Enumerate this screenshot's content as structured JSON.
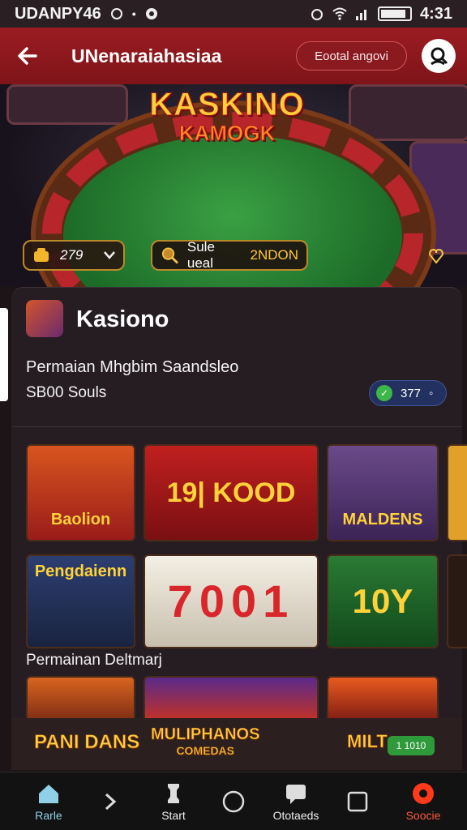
{
  "statusbar": {
    "left_text": "UDANPY46",
    "time": "4:31"
  },
  "appbar": {
    "title": "UNenaraiahasiaa",
    "action_label": "Eootal angovi"
  },
  "hero": {
    "title_line1": "KASKINO",
    "title_line2": "KAMOGK",
    "coin_value": "279",
    "search_label": "Sule ueal",
    "search_highlight": "2NDON"
  },
  "category": {
    "title": "Kasiono",
    "description1": "Permaian Mhgbim Saandsleo",
    "description2": "SB00 Souls",
    "score": "377"
  },
  "games_row1": [
    {
      "label": "Baolion",
      "bg": "#b4331f"
    },
    {
      "label": "19| KOOD",
      "bg": "#a8171b"
    },
    {
      "label": "MALDENS",
      "bg": "#5a3b7a"
    }
  ],
  "games_row2": [
    {
      "label": "Pengdaienn",
      "bg": "#26345a"
    },
    {
      "label": "7001",
      "bg": "#e8e1d2"
    },
    {
      "label": "10Y",
      "bg": "#1f6a2c"
    }
  ],
  "section2_title": "Permainan Deltmarj",
  "promo": {
    "item1": "PANI DANS",
    "item2_line1": "MULIPHANOS",
    "item2_line2": "COMEDAS",
    "item3": "MILT",
    "badge": "1 1010"
  },
  "bottom_nav": [
    {
      "label": "Rarle",
      "icon": "home-icon"
    },
    {
      "label": "",
      "icon": "chevron-right-icon"
    },
    {
      "label": "Start",
      "icon": "rook-icon"
    },
    {
      "label": "",
      "icon": "circle-icon"
    },
    {
      "label": "Ototaeds",
      "icon": "chat-icon"
    },
    {
      "label": "",
      "icon": "square-icon"
    },
    {
      "label": "Soocie",
      "icon": "record-icon"
    }
  ],
  "colors": {
    "appbar": "#9b1c22",
    "accent_gold": "#ffcf3a",
    "nav_active": "#8fd0e6"
  }
}
